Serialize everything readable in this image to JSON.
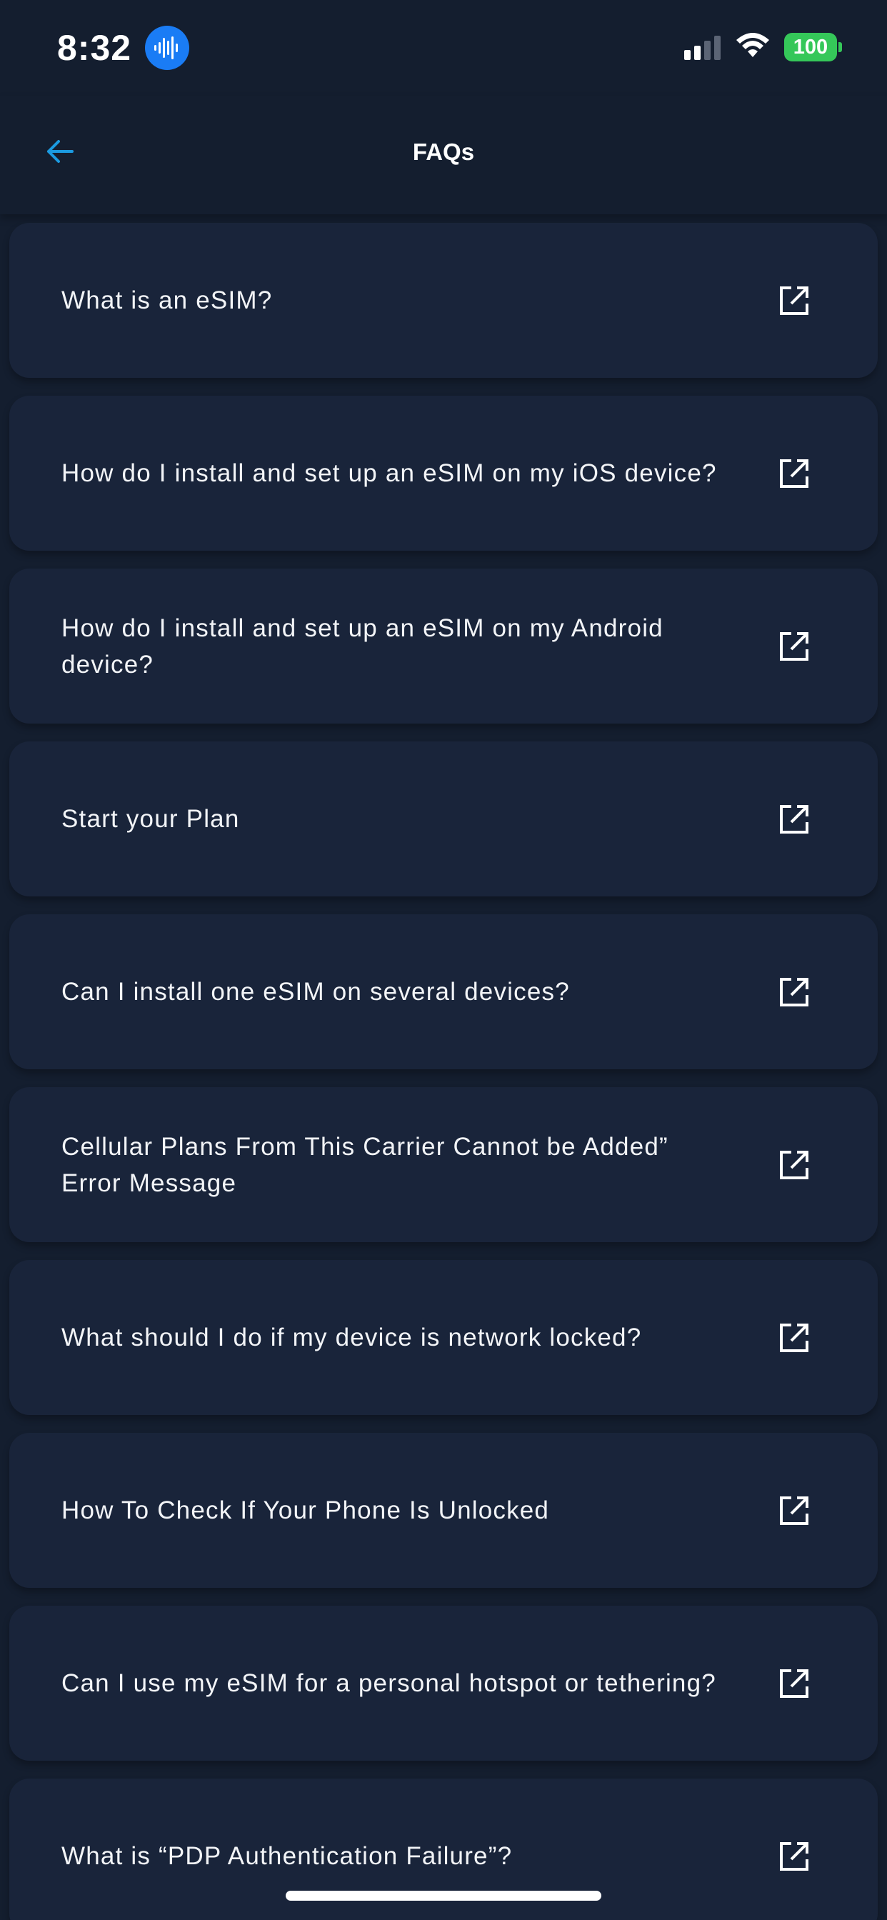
{
  "status_bar": {
    "time": "8:32",
    "battery": "100",
    "icons": [
      "siri-waveform-icon",
      "cellular-signal-icon",
      "wifi-icon",
      "battery-icon"
    ]
  },
  "header": {
    "title": "FAQs",
    "back_icon": "arrow-left-icon"
  },
  "colors": {
    "background": "#141e2f",
    "card": "#19243a",
    "accent": "#1b9ae0",
    "battery": "#35c759",
    "siri": "#1a7cf5",
    "text": "#f2f4f7"
  },
  "faqs": [
    {
      "label": "What is an eSIM?",
      "icon": "external-link-icon"
    },
    {
      "label": "How do I install and set up an eSIM on my iOS device?",
      "icon": "external-link-icon"
    },
    {
      "label": "How do I install and set up an eSIM on my Android device?",
      "icon": "external-link-icon"
    },
    {
      "label": "Start your Plan",
      "icon": "external-link-icon"
    },
    {
      "label": "Can I install one eSIM on several devices?",
      "icon": "external-link-icon"
    },
    {
      "label": "Cellular Plans From This Carrier Cannot be Added” Error Message",
      "icon": "external-link-icon"
    },
    {
      "label": "What should I do if my device is network locked?",
      "icon": "external-link-icon"
    },
    {
      "label": "How To Check If Your Phone Is Unlocked",
      "icon": "external-link-icon"
    },
    {
      "label": "Can I use my eSIM for a personal hotspot or tethering?",
      "icon": "external-link-icon"
    },
    {
      "label": "What is “PDP Authentication Failure”?",
      "icon": "external-link-icon"
    }
  ]
}
